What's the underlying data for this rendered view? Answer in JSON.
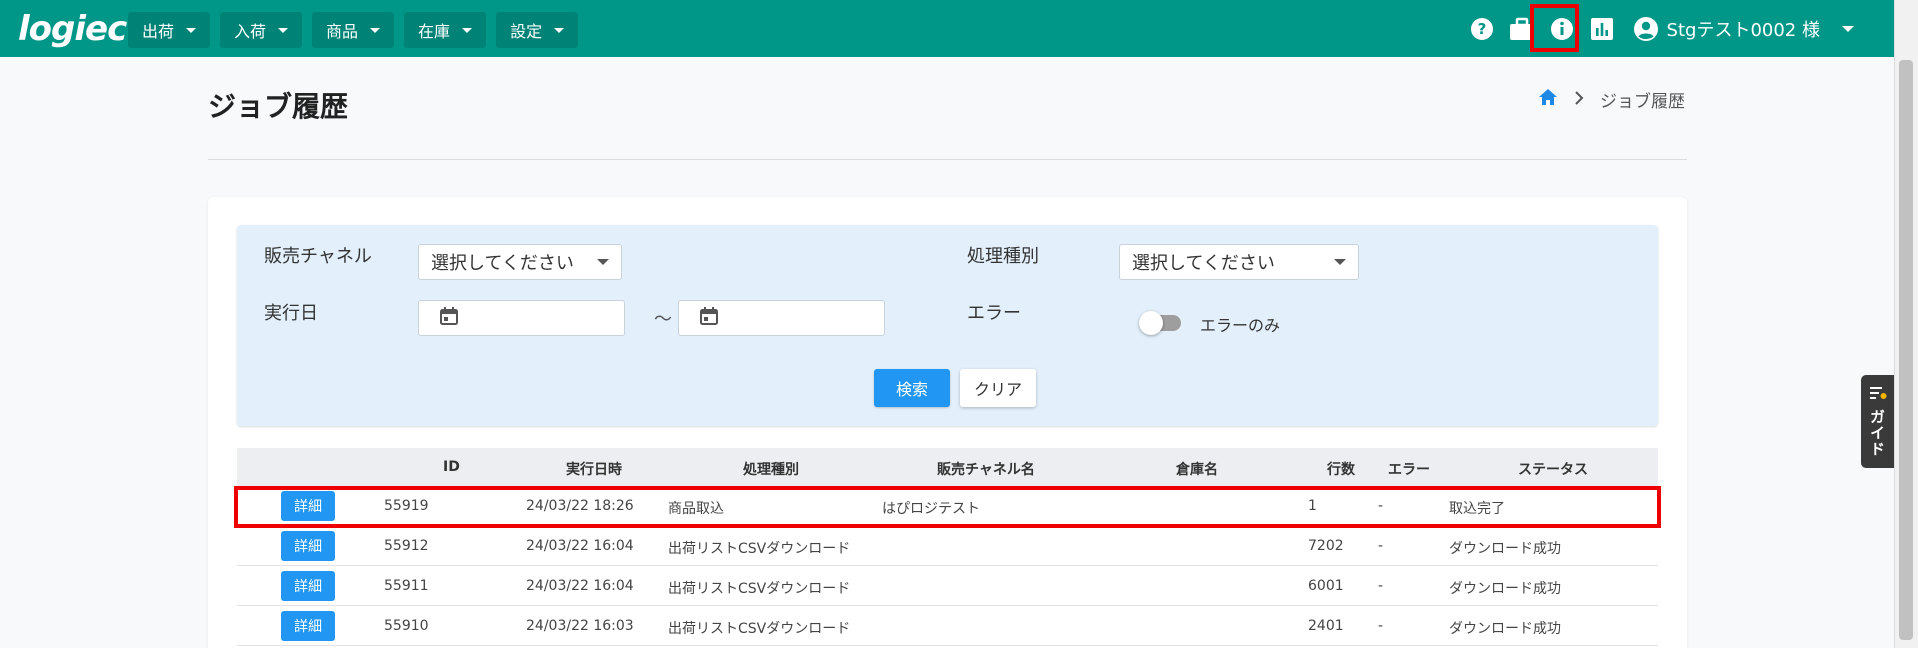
{
  "app": {
    "logo": "logiec"
  },
  "menu": [
    {
      "label": "出荷"
    },
    {
      "label": "入荷"
    },
    {
      "label": "商品"
    },
    {
      "label": "在庫"
    },
    {
      "label": "設定"
    }
  ],
  "user": {
    "name": "Stgテスト0002 様"
  },
  "page": {
    "title": "ジョブ履歴",
    "breadcrumb_current": "ジョブ履歴"
  },
  "filter": {
    "channel_label": "販売チャネル",
    "channel_value": "選択してください",
    "type_label": "処理種別",
    "type_value": "選択してください",
    "date_label": "実行日",
    "tilde": "～",
    "error_label": "エラー",
    "error_toggle_label": "エラーのみ",
    "search_label": "検索",
    "clear_label": "クリア"
  },
  "table": {
    "headers": {
      "id": "ID",
      "datetime": "実行日時",
      "type": "処理種別",
      "channel": "販売チャネル名",
      "warehouse": "倉庫名",
      "rows": "行数",
      "error": "エラー",
      "status": "ステータス"
    },
    "detail_label": "詳細",
    "rows": [
      {
        "id": "55919",
        "datetime": "24/03/22 18:26",
        "type": "商品取込",
        "channel": "はぴロジテスト",
        "warehouse": "",
        "rows": "1",
        "error": "-",
        "status": "取込完了"
      },
      {
        "id": "55912",
        "datetime": "24/03/22 16:04",
        "type": "出荷リストCSVダウンロード",
        "channel": "",
        "warehouse": "",
        "rows": "7202",
        "error": "-",
        "status": "ダウンロード成功"
      },
      {
        "id": "55911",
        "datetime": "24/03/22 16:04",
        "type": "出荷リストCSVダウンロード",
        "channel": "",
        "warehouse": "",
        "rows": "6001",
        "error": "-",
        "status": "ダウンロード成功"
      },
      {
        "id": "55910",
        "datetime": "24/03/22 16:03",
        "type": "出荷リストCSVダウンロード",
        "channel": "",
        "warehouse": "",
        "rows": "2401",
        "error": "-",
        "status": "ダウンロード成功"
      }
    ]
  },
  "guide": {
    "label": "ガイド"
  },
  "colors": {
    "topbar": "#009688",
    "primary": "#2196f3",
    "highlight": "#e00000"
  },
  "icons": [
    "help-icon",
    "briefcase-icon",
    "info-icon",
    "bar-chart-icon",
    "account-icon",
    "home-icon",
    "chevron-right-icon",
    "calendar-icon"
  ]
}
